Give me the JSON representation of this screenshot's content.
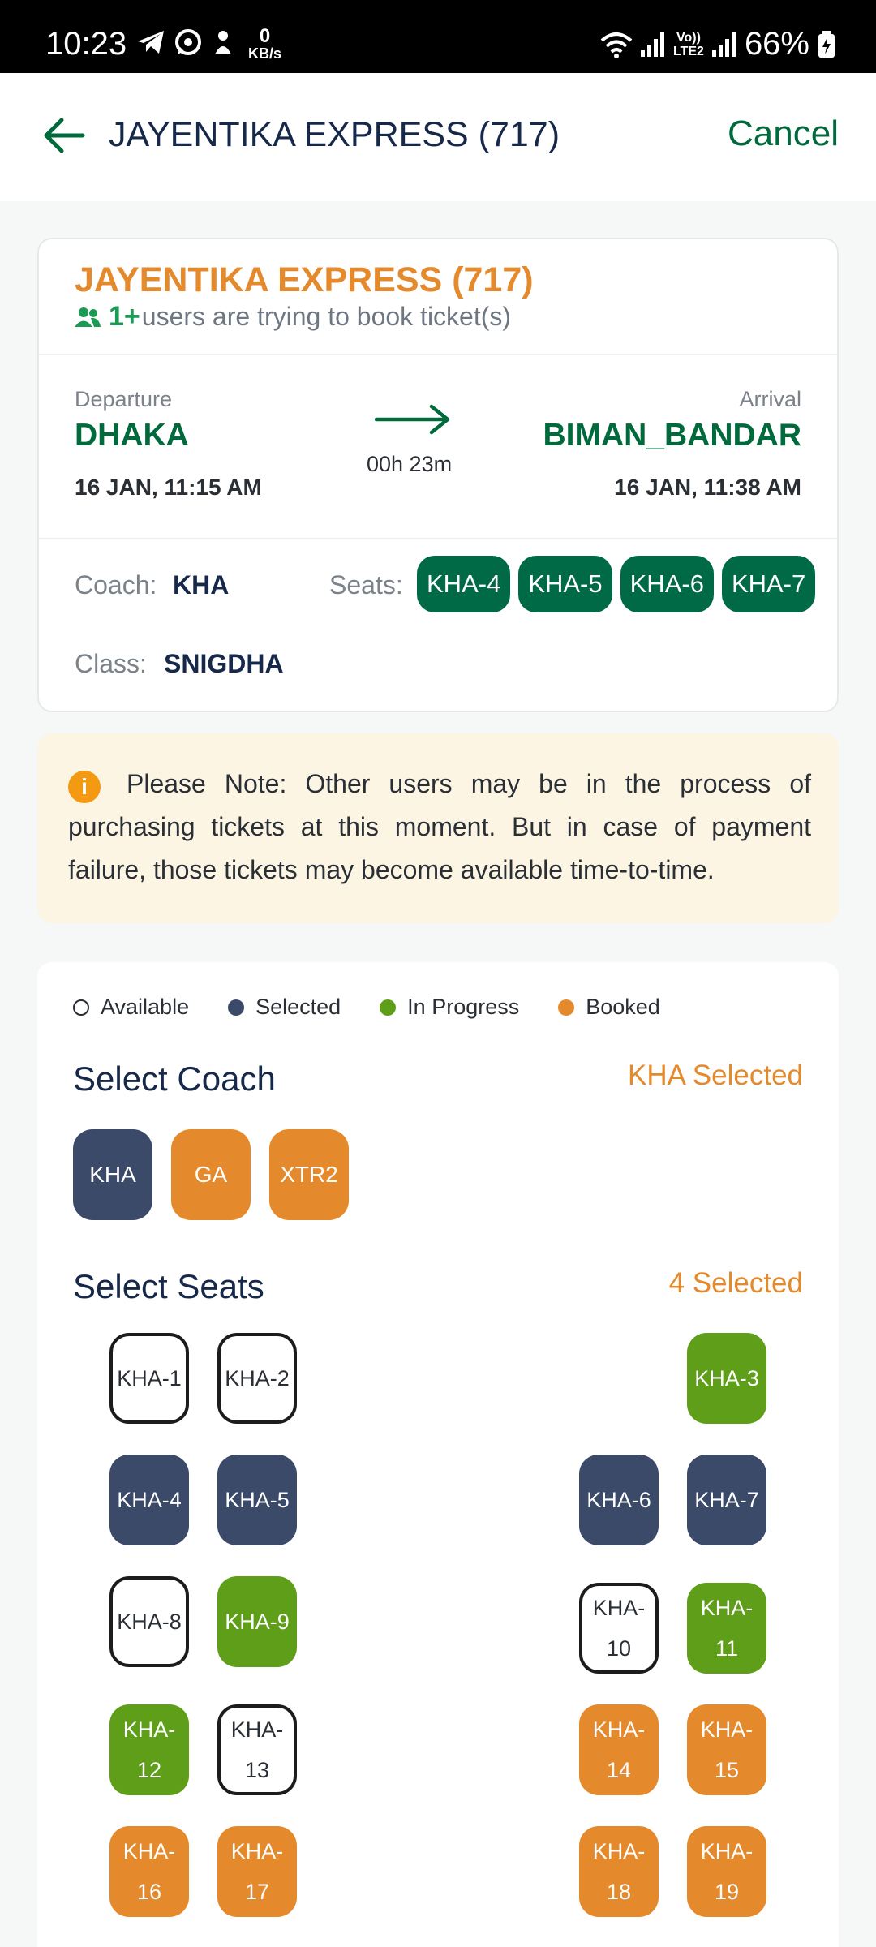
{
  "status_bar": {
    "time": "10:23",
    "net_speed_value": "0",
    "net_speed_unit": "KB/s",
    "lte_top": "Vo))",
    "lte_bottom": "LTE2",
    "battery": "66%"
  },
  "app_bar": {
    "title": "JAYENTIKA EXPRESS (717)",
    "cancel_label": "Cancel"
  },
  "trip": {
    "train_name": "JAYENTIKA EXPRESS (717)",
    "users_count": "1+",
    "users_text": "users are trying to book ticket(s)",
    "departure_label": "Departure",
    "departure_station": "DHAKA",
    "departure_time": "16 JAN, 11:15 AM",
    "arrival_label": "Arrival",
    "arrival_station": "BIMAN_BANDAR",
    "arrival_time": "16 JAN, 11:38 AM",
    "duration": "00h 23m",
    "coach_label": "Coach:",
    "coach_value": "KHA",
    "seats_label": "Seats:",
    "seats": [
      "KHA-4",
      "KHA-5",
      "KHA-6",
      "KHA-7"
    ],
    "class_label": "Class:",
    "class_value": "SNIGDHA"
  },
  "note": {
    "text": "Please Note: Other users may be in the process of purchasing tickets at this moment. But in case of payment failure, those tickets may become available time-to-time."
  },
  "legend": {
    "available": "Available",
    "selected": "Selected",
    "in_progress": "In Progress",
    "booked": "Booked"
  },
  "colors": {
    "primary_green": "#006a3d",
    "orange": "#e48a2c",
    "selected_navy": "#3a4a68",
    "in_progress_green": "#5e9e18"
  },
  "coach_section": {
    "title": "Select Coach",
    "status": "KHA Selected",
    "coaches": [
      {
        "label": "KHA",
        "state": "selected"
      },
      {
        "label": "GA",
        "state": "booked"
      },
      {
        "label": "XTR2",
        "state": "booked"
      }
    ]
  },
  "seat_section": {
    "title": "Select Seats",
    "status": "4 Selected",
    "seats": [
      {
        "label": "KHA-1",
        "state": "available"
      },
      {
        "label": "KHA-2",
        "state": "available"
      },
      {
        "label": "KHA-3",
        "state": "in_progress"
      },
      {
        "label": "KHA-4",
        "state": "selected"
      },
      {
        "label": "KHA-5",
        "state": "selected"
      },
      {
        "label": "KHA-6",
        "state": "selected"
      },
      {
        "label": "KHA-7",
        "state": "selected"
      },
      {
        "label": "KHA-8",
        "state": "available"
      },
      {
        "label": "KHA-9",
        "state": "in_progress"
      },
      {
        "label": "KHA-10",
        "state": "available"
      },
      {
        "label": "KHA-11",
        "state": "in_progress"
      },
      {
        "label": "KHA-12",
        "state": "in_progress"
      },
      {
        "label": "KHA-13",
        "state": "available"
      },
      {
        "label": "KHA-14",
        "state": "booked"
      },
      {
        "label": "KHA-15",
        "state": "booked"
      },
      {
        "label": "KHA-16",
        "state": "booked"
      },
      {
        "label": "KHA-17",
        "state": "booked"
      },
      {
        "label": "KHA-18",
        "state": "booked"
      },
      {
        "label": "KHA-19",
        "state": "booked"
      }
    ]
  }
}
